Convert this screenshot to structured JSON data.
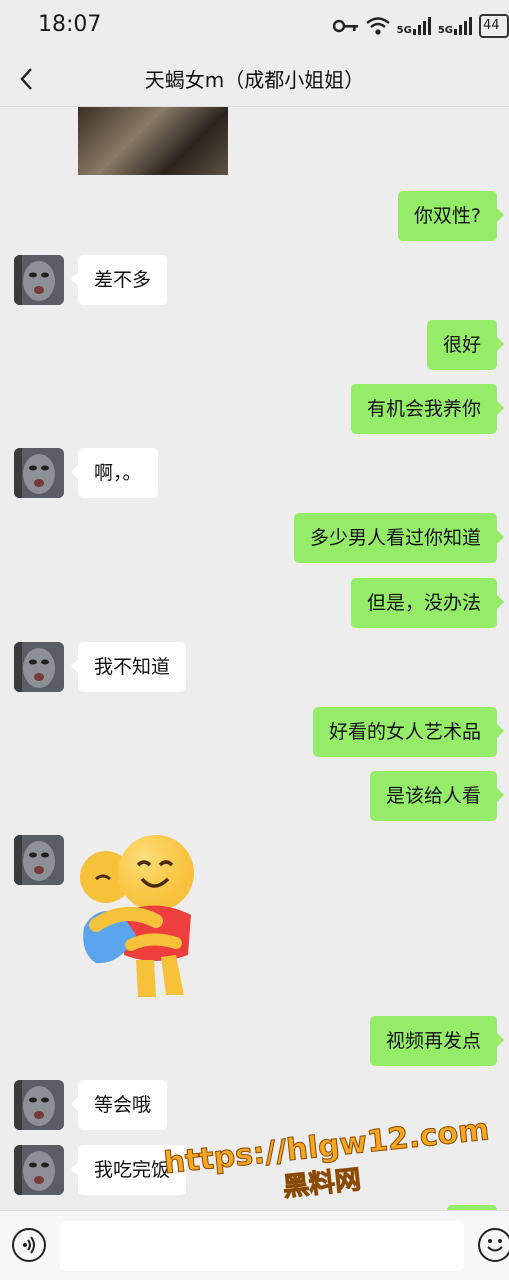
{
  "status_bar": {
    "time": "18:07",
    "network_1": "5G",
    "network_2": "5G",
    "battery": "44"
  },
  "header": {
    "title": "天蝎女m（成都小姐姐）",
    "back_icon": "chevron-left-icon"
  },
  "messages": [
    {
      "side": "out",
      "text": "你双性?"
    },
    {
      "side": "in",
      "text": "差不多"
    },
    {
      "side": "out",
      "text": "很好"
    },
    {
      "side": "out",
      "text": "有机会我养你"
    },
    {
      "side": "in",
      "text": "啊，。"
    },
    {
      "side": "out",
      "text": "多少男人看过你知道"
    },
    {
      "side": "out",
      "text": "但是，没办法"
    },
    {
      "side": "in",
      "text": "我不知道"
    },
    {
      "side": "out",
      "text": "好看的女人艺术品"
    },
    {
      "side": "out",
      "text": "是该给人看"
    },
    {
      "side": "in",
      "type": "sticker",
      "sticker": "hug-emoji-sticker"
    },
    {
      "side": "out",
      "text": "视频再发点"
    },
    {
      "side": "in",
      "text": "等会哦"
    },
    {
      "side": "in",
      "text": "我吃完饭"
    }
  ],
  "watermark": {
    "url": "https://hlgw12.com",
    "name": "黑料网"
  },
  "input_bar": {
    "voice_icon": "voice-icon",
    "value": "",
    "emoji_icon": "emoji-icon"
  },
  "colors": {
    "background": "#ededed",
    "outgoing_bubble": "#95ec69",
    "incoming_bubble": "#ffffff",
    "watermark": "#f5a623"
  }
}
